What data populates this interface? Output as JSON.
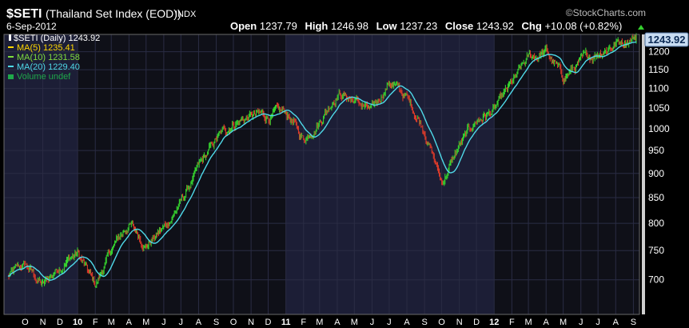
{
  "header": {
    "symbol": "$SETI",
    "name": "(Thailand Set Index (EOD))",
    "exchange": "INDX",
    "date": "6-Sep-2012",
    "watermark": "©StockCharts.com",
    "open_label": "Open",
    "open": "1237.79",
    "high_label": "High",
    "high": "1246.98",
    "low_label": "Low",
    "low": "1237.23",
    "close_label": "Close",
    "close": "1243.92",
    "chg_label": "Chg",
    "chg": "+10.08 (+0.82%)"
  },
  "legend": [
    {
      "text": "$SETI (Daily) 1243.92",
      "color": "#ffffff"
    },
    {
      "text": "MA(5) 1235.41",
      "color": "#ffd700"
    },
    {
      "text": "MA(10) 1231.58",
      "color": "#7fdc3c"
    },
    {
      "text": "MA(20) 1229.40",
      "color": "#4fd9e8"
    },
    {
      "text": "Volume undef",
      "color": "#1fa84a"
    }
  ],
  "last_price_tag": "1243.92",
  "colors": {
    "background": "#000000",
    "band_dark": "#0f1018",
    "band_light": "#1c1e36",
    "grid": "#2a2c44",
    "up": "#35d12e",
    "down": "#d83a2a",
    "ma20": "#4fd9e8",
    "axis_bar": "#cfcfcf",
    "tag": "#c8dcf2"
  },
  "chart_data": {
    "type": "line",
    "title": "$SETI (Thailand Set Index (EOD)) INDX",
    "series_label": "$SETI (Daily)",
    "y_scale": "log",
    "ylim": [
      645,
      1250
    ],
    "y_ticks": [
      700,
      750,
      800,
      850,
      900,
      950,
      1000,
      1050,
      1100,
      1150,
      1200
    ],
    "x_ticks": [
      "O",
      "N",
      "D",
      "10",
      "F",
      "M",
      "A",
      "M",
      "J",
      "J",
      "A",
      "S",
      "O",
      "N",
      "D",
      "11",
      "F",
      "M",
      "A",
      "M",
      "J",
      "J",
      "A",
      "S",
      "O",
      "N",
      "D",
      "12",
      "F",
      "M",
      "A",
      "M",
      "J",
      "J",
      "A",
      "S"
    ],
    "x_range": [
      "2009-09",
      "2012-09-06"
    ],
    "closes": [
      {
        "x": "2009-09",
        "y": 705
      },
      {
        "x": "2009-10",
        "y": 725
      },
      {
        "x": "2009-11",
        "y": 690
      },
      {
        "x": "2009-12",
        "y": 725
      },
      {
        "x": "2010-01",
        "y": 745
      },
      {
        "x": "2010-02",
        "y": 690
      },
      {
        "x": "2010-03",
        "y": 750
      },
      {
        "x": "2010-04",
        "y": 800
      },
      {
        "x": "2010-05",
        "y": 760
      },
      {
        "x": "2010-06",
        "y": 790
      },
      {
        "x": "2010-07",
        "y": 840
      },
      {
        "x": "2010-08",
        "y": 910
      },
      {
        "x": "2010-09",
        "y": 975
      },
      {
        "x": "2010-10",
        "y": 1015
      },
      {
        "x": "2010-11",
        "y": 1030
      },
      {
        "x": "2010-12",
        "y": 1030
      },
      {
        "x": "2011-01",
        "y": 1040
      },
      {
        "x": "2011-02",
        "y": 975
      },
      {
        "x": "2011-03",
        "y": 1020
      },
      {
        "x": "2011-04",
        "y": 1090
      },
      {
        "x": "2011-05",
        "y": 1070
      },
      {
        "x": "2011-06",
        "y": 1040
      },
      {
        "x": "2011-07",
        "y": 1120
      },
      {
        "x": "2011-08",
        "y": 1075
      },
      {
        "x": "2011-09",
        "y": 1000
      },
      {
        "x": "2011-10",
        "y": 880
      },
      {
        "x": "2011-11",
        "y": 960
      },
      {
        "x": "2011-12",
        "y": 1020
      },
      {
        "x": "2012-01",
        "y": 1045
      },
      {
        "x": "2012-02",
        "y": 1110
      },
      {
        "x": "2012-03",
        "y": 1180
      },
      {
        "x": "2012-04",
        "y": 1200
      },
      {
        "x": "2012-05",
        "y": 1130
      },
      {
        "x": "2012-06",
        "y": 1170
      },
      {
        "x": "2012-07",
        "y": 1200
      },
      {
        "x": "2012-08",
        "y": 1225
      },
      {
        "x": "2012-09-06",
        "y": 1243.92
      }
    ]
  }
}
